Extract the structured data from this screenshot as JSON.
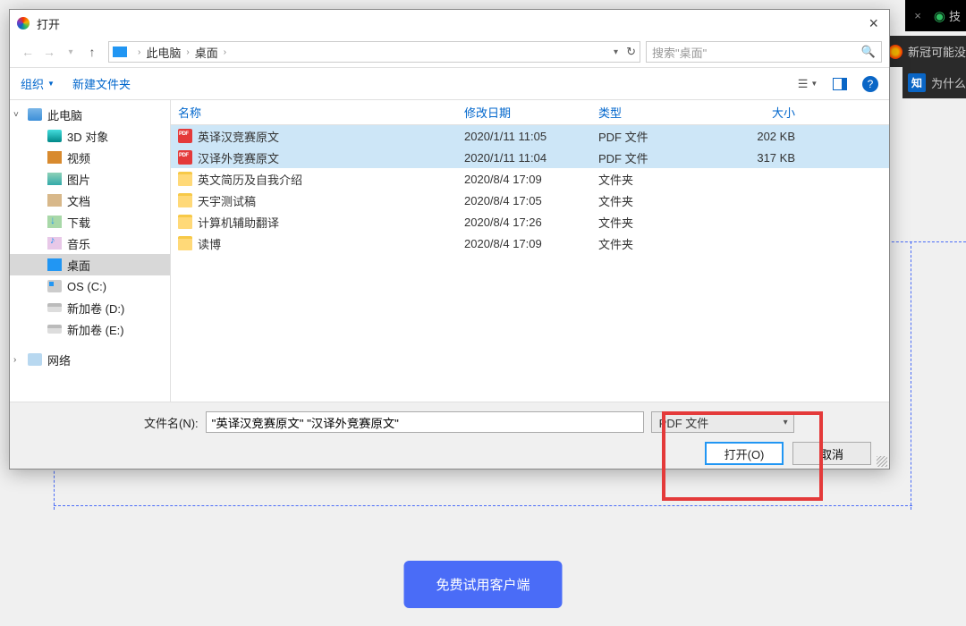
{
  "browser": {
    "tab_partial": "技",
    "tab2_partial": "新冠可能没",
    "tab3_partial": "为什么"
  },
  "dialog": {
    "title": "打开",
    "path1": "此电脑",
    "path2": "桌面",
    "search_placeholder": "搜索\"桌面\"",
    "toolbar": {
      "organize": "组织",
      "newfolder": "新建文件夹"
    },
    "columns": {
      "name": "名称",
      "date": "修改日期",
      "type": "类型",
      "size": "大小"
    },
    "sidebar": {
      "thispc": "此电脑",
      "threed": "3D 对象",
      "video": "视频",
      "pictures": "图片",
      "documents": "文档",
      "downloads": "下载",
      "music": "音乐",
      "desktop": "桌面",
      "osc": "OS (C:)",
      "dvol_d": "新加卷 (D:)",
      "dvol_e": "新加卷 (E:)",
      "network": "网络"
    },
    "files": [
      {
        "name": "英译汉竞赛原文",
        "date": "2020/1/11 11:05",
        "type": "PDF 文件",
        "size": "202 KB",
        "icon": "pdf",
        "selected": true
      },
      {
        "name": "汉译外竞赛原文",
        "date": "2020/1/11 11:04",
        "type": "PDF 文件",
        "size": "317 KB",
        "icon": "pdf",
        "selected": true
      },
      {
        "name": "英文简历及自我介绍",
        "date": "2020/8/4 17:09",
        "type": "文件夹",
        "size": "",
        "icon": "folder",
        "selected": false
      },
      {
        "name": "天宇测试稿",
        "date": "2020/8/4 17:05",
        "type": "文件夹",
        "size": "",
        "icon": "folder",
        "selected": false
      },
      {
        "name": "计算机辅助翻译",
        "date": "2020/8/4 17:26",
        "type": "文件夹",
        "size": "",
        "icon": "folder",
        "selected": false
      },
      {
        "name": "读博",
        "date": "2020/8/4 17:09",
        "type": "文件夹",
        "size": "",
        "icon": "folder",
        "selected": false
      }
    ],
    "footer": {
      "filename_label": "文件名(N):",
      "filename_value": "\"英译汉竞赛原文\" \"汉译外竞赛原文\"",
      "filetype": "PDF 文件",
      "open_btn": "打开(O)",
      "cancel_btn": "取消"
    }
  },
  "page": {
    "big_button": "免费试用客户端"
  }
}
